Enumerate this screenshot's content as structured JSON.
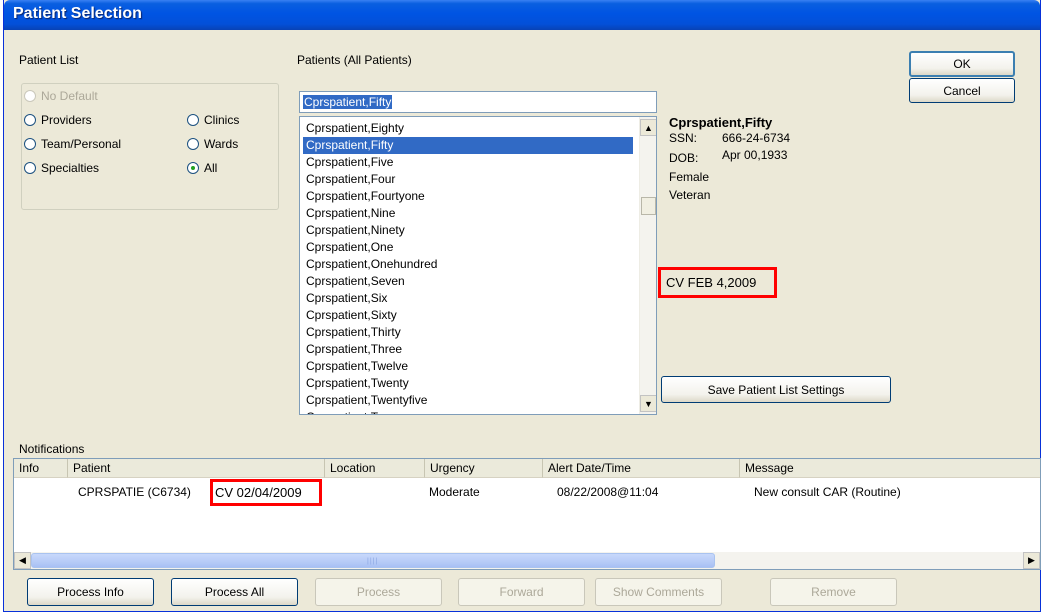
{
  "window": {
    "title": "Patient Selection"
  },
  "patient_list": {
    "label": "Patient List",
    "options": [
      {
        "label": "No Default",
        "checked": false,
        "disabled": true
      },
      {
        "label": "Providers",
        "checked": false,
        "disabled": false
      },
      {
        "label": "Team/Personal",
        "checked": false,
        "disabled": false
      },
      {
        "label": "Specialties",
        "checked": false,
        "disabled": false
      },
      {
        "label": "Clinics",
        "checked": false,
        "disabled": false
      },
      {
        "label": "Wards",
        "checked": false,
        "disabled": false
      },
      {
        "label": "All",
        "checked": true,
        "disabled": false
      }
    ]
  },
  "patients": {
    "label": "Patients (All Patients)",
    "search_value": "Cprspatient,Fifty",
    "selected_index": 1,
    "items": [
      "Cprspatient,Eighty",
      "Cprspatient,Fifty",
      "Cprspatient,Five",
      "Cprspatient,Four",
      "Cprspatient,Fourtyone",
      "Cprspatient,Nine",
      "Cprspatient,Ninety",
      "Cprspatient,One",
      "Cprspatient,Onehundred",
      "Cprspatient,Seven",
      "Cprspatient,Six",
      "Cprspatient,Sixty",
      "Cprspatient,Thirty",
      "Cprspatient,Three",
      "Cprspatient,Twelve",
      "Cprspatient,Twenty",
      "Cprspatient,Twentyfive",
      "Cprspatient,Two"
    ]
  },
  "details": {
    "name": "Cprspatient,Fifty",
    "ssn_label": "SSN:",
    "ssn": "666-24-6734",
    "dob_label": "DOB:",
    "dob": "Apr 00,1933",
    "sex": "Female",
    "status": "Veteran",
    "cv_flag": "CV FEB 4,2009"
  },
  "buttons": {
    "ok": "OK",
    "cancel": "Cancel",
    "save_settings": "Save Patient List Settings",
    "process_info": "Process Info",
    "process_all": "Process All",
    "process": "Process",
    "forward": "Forward",
    "show_comments": "Show Comments",
    "remove": "Remove"
  },
  "notifications": {
    "label": "Notifications",
    "columns": [
      "Info",
      "Patient",
      "Location",
      "Urgency",
      "Alert Date/Time",
      "Message"
    ],
    "row": {
      "info": "",
      "patient": "CPRSPATIE (C6734)",
      "cv": "CV 02/04/2009",
      "location": "",
      "urgency": "Moderate",
      "alert_datetime": "08/22/2008@11:04",
      "message": "New consult CAR (Routine)"
    }
  },
  "colors": {
    "title_bar": "#0054e3",
    "dialog_bg": "#ece9d8",
    "selection": "#316ac5",
    "highlight_box": "#ff0000"
  }
}
